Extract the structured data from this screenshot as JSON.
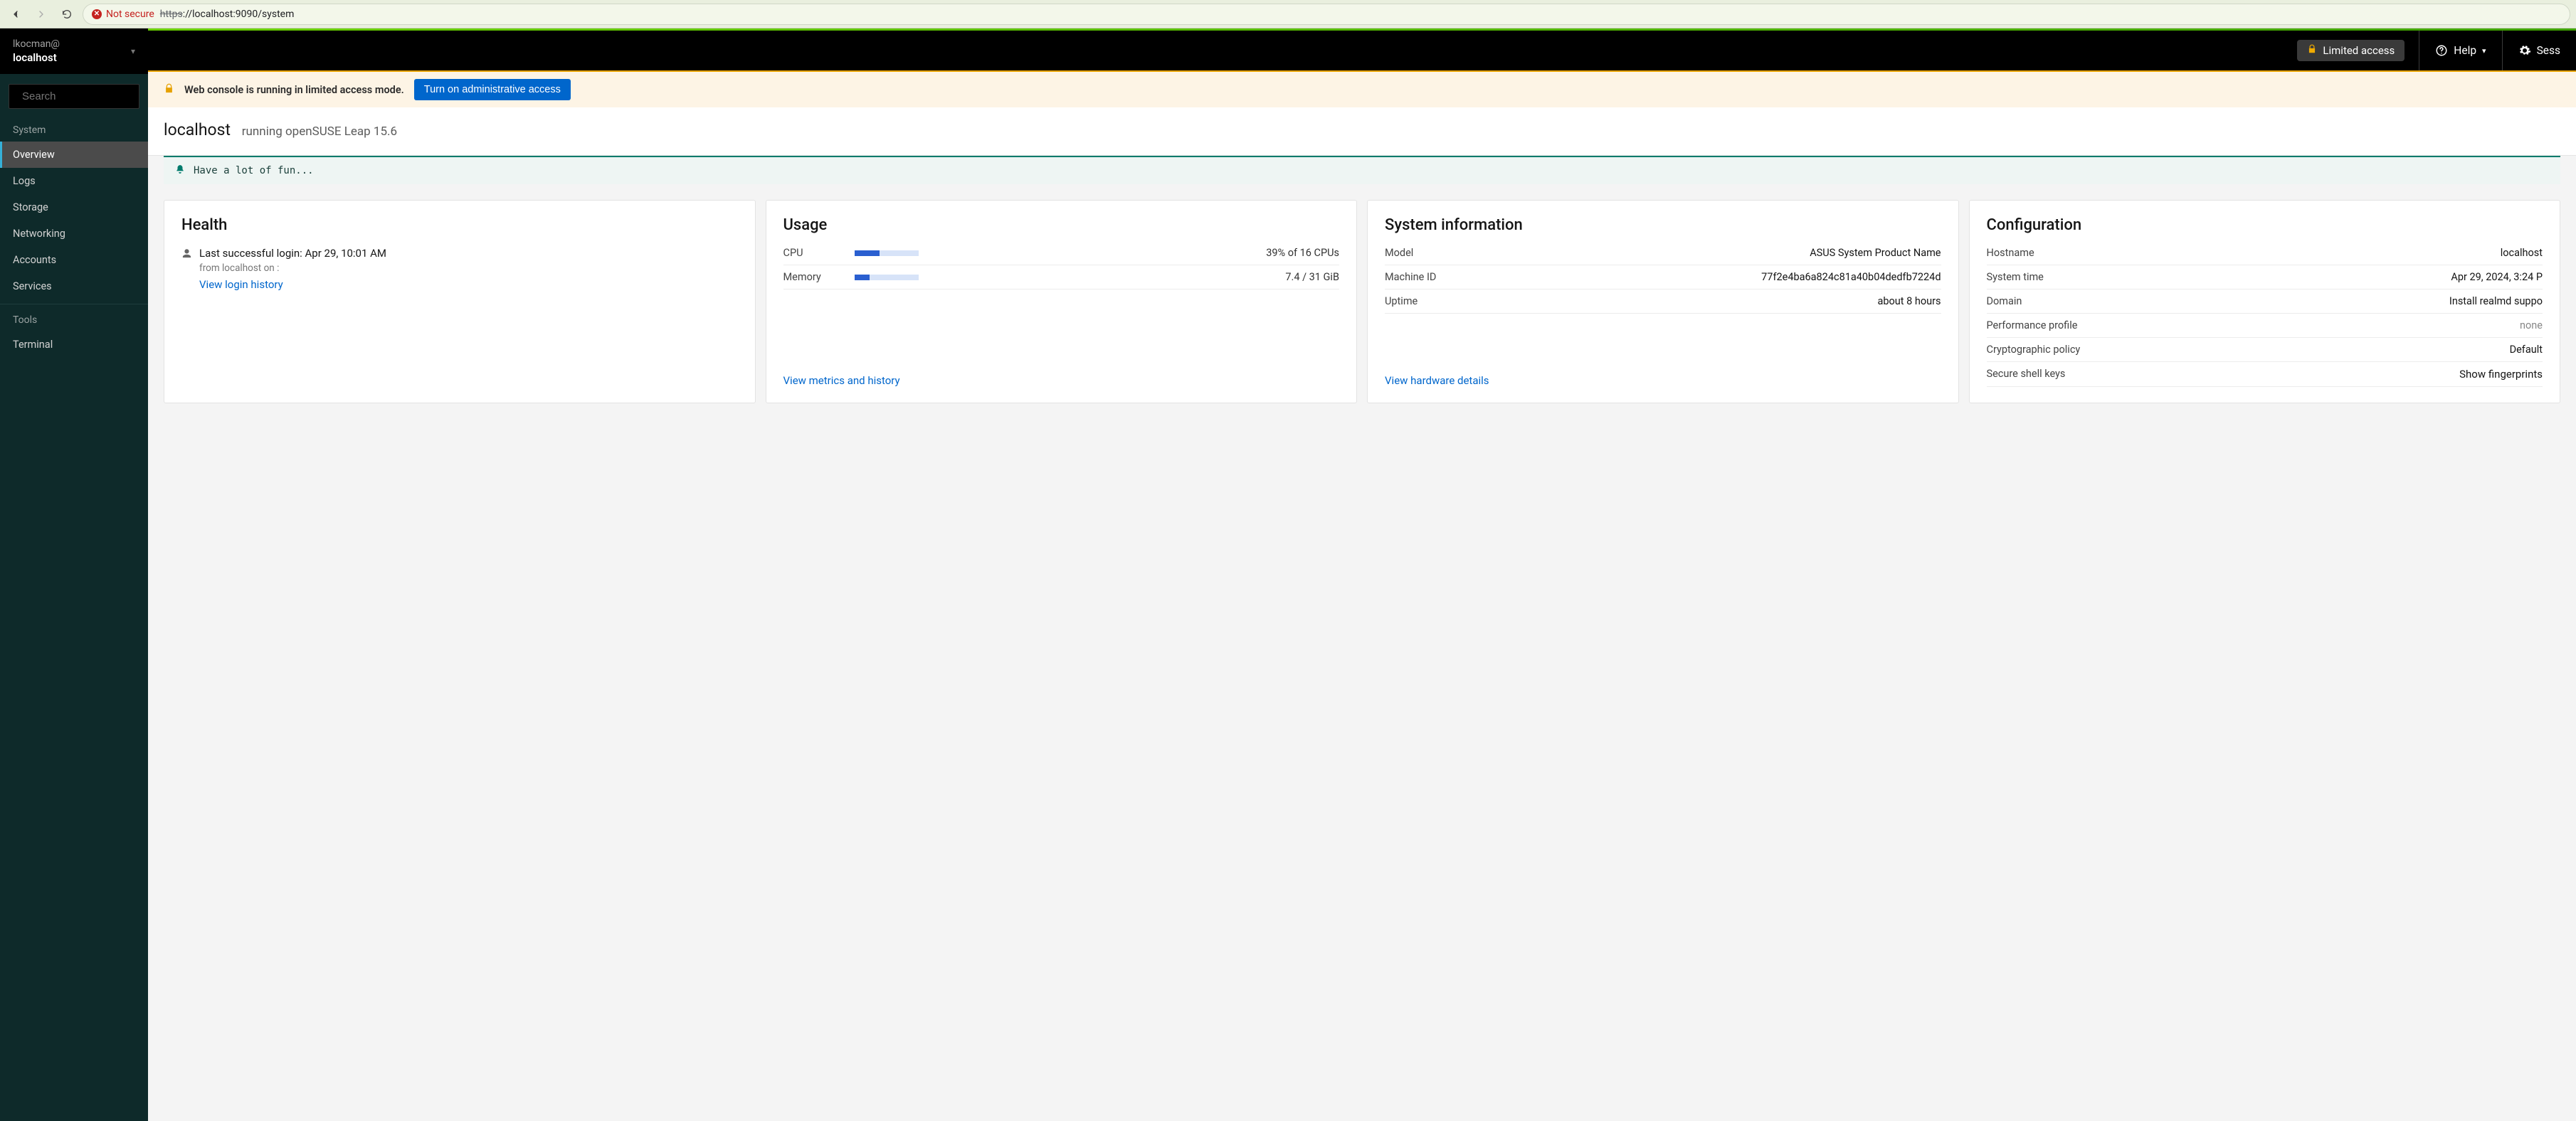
{
  "browser": {
    "not_secure_label": "Not secure",
    "url_scheme": "https",
    "url_rest": "://localhost:9090/system"
  },
  "sidebar": {
    "user": "lkocman@",
    "host": "localhost",
    "search_placeholder": "Search",
    "group_system": "System",
    "items": [
      {
        "label": "Overview"
      },
      {
        "label": "Logs"
      },
      {
        "label": "Storage"
      },
      {
        "label": "Networking"
      },
      {
        "label": "Accounts"
      },
      {
        "label": "Services"
      }
    ],
    "group_tools": "Tools",
    "tools": [
      {
        "label": "Terminal"
      }
    ]
  },
  "topbar": {
    "limited": "Limited access",
    "help": "Help",
    "session_prefix": "Sess"
  },
  "banner": {
    "message": "Web console is running in limited access mode.",
    "button": "Turn on administrative access"
  },
  "page": {
    "host": "localhost",
    "os": "running openSUSE Leap 15.6",
    "motd": "Have a lot of fun..."
  },
  "health": {
    "title": "Health",
    "last_login": "Last successful login: Apr 29, 10:01 AM",
    "from": "from localhost on :",
    "history_link": "View login history"
  },
  "usage": {
    "title": "Usage",
    "cpu_label": "CPU",
    "cpu_value": "39% of 16 CPUs",
    "cpu_pct": 39,
    "mem_label": "Memory",
    "mem_value": "7.4 / 31 GiB",
    "mem_pct": 24,
    "footer_link": "View metrics and history"
  },
  "sysinfo": {
    "title": "System information",
    "rows": [
      {
        "label": "Model",
        "value": "ASUS System Product Name"
      },
      {
        "label": "Machine ID",
        "value": "77f2e4ba6a824c81a40b04dedfb7224d"
      },
      {
        "label": "Uptime",
        "value": "about 8 hours"
      }
    ],
    "footer_link": "View hardware details"
  },
  "config": {
    "title": "Configuration",
    "rows": [
      {
        "label": "Hostname",
        "value": "localhost"
      },
      {
        "label": "System time",
        "value": "Apr 29, 2024, 3:24 P"
      },
      {
        "label": "Domain",
        "value": "Install realmd suppo"
      },
      {
        "label": "Performance profile",
        "value": "none",
        "muted": true
      },
      {
        "label": "Cryptographic policy",
        "value": "Default"
      },
      {
        "label": "Secure shell keys",
        "value": "Show fingerprints",
        "link": true
      }
    ]
  }
}
